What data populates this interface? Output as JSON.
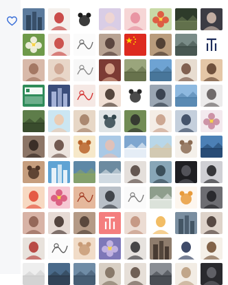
{
  "sidebar": {
    "favorite_icon": "heart-outline-icon"
  },
  "avatars": [
    {
      "label": "city-skyline",
      "bg": "#5b7a9c",
      "fg": "#2b3f55",
      "motif": "building"
    },
    {
      "label": "red-hat-girl",
      "bg": "#f4f0ec",
      "fg": "#c2302f",
      "motif": "face"
    },
    {
      "label": "panda",
      "bg": "#ffffff",
      "fg": "#1a1a1a",
      "motif": "animal"
    },
    {
      "label": "girl-purple",
      "bg": "#d9cde6",
      "fg": "#f1d6cf",
      "motif": "face"
    },
    {
      "label": "pink-girl",
      "bg": "#f6d6d6",
      "fg": "#e68a9a",
      "motif": "face"
    },
    {
      "label": "tulips",
      "bg": "#c8d9a6",
      "fg": "#e0503a",
      "motif": "flower"
    },
    {
      "label": "dark-forest",
      "bg": "#2e3b2a",
      "fg": "#6f7f55",
      "motif": "landscape"
    },
    {
      "label": "girl-dark",
      "bg": "#3c3c44",
      "fg": "#d9c1b3",
      "motif": "face"
    },
    {
      "label": "white-flower",
      "bg": "#6f9a4a",
      "fg": "#f8f5e8",
      "motif": "flower"
    },
    {
      "label": "santa-girl",
      "bg": "#f2e4e0",
      "fg": "#c53a35",
      "motif": "face"
    },
    {
      "label": "cartoon-sketch",
      "bg": "#fbfbfb",
      "fg": "#6b6b6b",
      "motif": "sketch"
    },
    {
      "label": "woman-portrait",
      "bg": "#b8a393",
      "fg": "#4a3630",
      "motif": "face"
    },
    {
      "label": "china-flag",
      "bg": "#dd2a1f",
      "fg": "#ffd400",
      "motif": "flag"
    },
    {
      "label": "man-temple",
      "bg": "#b99c7d",
      "fg": "#3f3128",
      "motif": "face"
    },
    {
      "label": "mountain-road",
      "bg": "#7a8c88",
      "fg": "#3c4a45",
      "motif": "landscape"
    },
    {
      "label": "logo-mark",
      "bg": "#ffffff",
      "fg": "#1c2b5a",
      "motif": "logo"
    },
    {
      "label": "hands",
      "bg": "#d8b9a9",
      "fg": "#9b6c58",
      "motif": "face"
    },
    {
      "label": "girl-sand",
      "bg": "#e8d6c8",
      "fg": "#caa08c",
      "motif": "face"
    },
    {
      "label": "text-sketch",
      "bg": "#f7f7f7",
      "fg": "#888888",
      "motif": "sketch"
    },
    {
      "label": "man-red",
      "bg": "#7c3b34",
      "fg": "#e5b59a",
      "motif": "face"
    },
    {
      "label": "field",
      "bg": "#9aa57c",
      "fg": "#5a6540",
      "motif": "landscape"
    },
    {
      "label": "lake-sky",
      "bg": "#6ea3d3",
      "fg": "#3e6a8c",
      "motif": "landscape"
    },
    {
      "label": "girl-smile",
      "bg": "#e7dcd0",
      "fg": "#6e4a3a",
      "motif": "face"
    },
    {
      "label": "old-man",
      "bg": "#e4c7a7",
      "fg": "#5b3c2a",
      "motif": "face"
    },
    {
      "label": "qr-card",
      "bg": "#2f8c5a",
      "fg": "#ffffff",
      "motif": "qr"
    },
    {
      "label": "city-night",
      "bg": "#3a4d7a",
      "fg": "#b9c4e8",
      "motif": "building"
    },
    {
      "label": "red-lantern",
      "bg": "#f5e8e4",
      "fg": "#d32f2f",
      "motif": "sketch"
    },
    {
      "label": "cute-girl",
      "bg": "#f1e0d5",
      "fg": "#3a2a22",
      "motif": "face"
    },
    {
      "label": "cartoon-bird",
      "bg": "#ffffff",
      "fg": "#2a2a2a",
      "motif": "animal"
    },
    {
      "label": "man-suit",
      "bg": "#9aa6b3",
      "fg": "#2a3340",
      "motif": "face"
    },
    {
      "label": "sea-sky",
      "bg": "#8eb9e0",
      "fg": "#4d7ea8",
      "motif": "landscape"
    },
    {
      "label": "man-glasses",
      "bg": "#ecebeb",
      "fg": "#5a5555",
      "motif": "face"
    },
    {
      "label": "tree-road",
      "bg": "#5e7d4a",
      "fg": "#2f4025",
      "motif": "landscape"
    },
    {
      "label": "cartoon-baby",
      "bg": "#cbe6f2",
      "fg": "#f1c7a8",
      "motif": "face"
    },
    {
      "label": "baby-face",
      "bg": "#e7d7c6",
      "fg": "#a07a60",
      "motif": "face"
    },
    {
      "label": "white-bird",
      "bg": "#dfe4e6",
      "fg": "#33474e",
      "motif": "animal"
    },
    {
      "label": "man-outdoor",
      "bg": "#718c55",
      "fg": "#2b2b2b",
      "motif": "face"
    },
    {
      "label": "woman-drawing",
      "bg": "#f4ede6",
      "fg": "#c49a82",
      "motif": "face"
    },
    {
      "label": "man-blue",
      "bg": "#c4cfdc",
      "fg": "#2f3e57",
      "motif": "face"
    },
    {
      "label": "flower-pink",
      "bg": "#f3e9ee",
      "fg": "#c98a9e",
      "motif": "flower"
    },
    {
      "label": "man-beard",
      "bg": "#8c7566",
      "fg": "#2d221c",
      "motif": "face"
    },
    {
      "label": "girl-white",
      "bg": "#ece4de",
      "fg": "#5d4238",
      "motif": "face"
    },
    {
      "label": "monkey-king",
      "bg": "#f6e8c9",
      "fg": "#b9632b",
      "motif": "animal"
    },
    {
      "label": "girl-beach",
      "bg": "#a9c9e6",
      "fg": "#e9c0b0",
      "motif": "face"
    },
    {
      "label": "ocean-cloud",
      "bg": "#7ea6cf",
      "fg": "#ffffff",
      "motif": "landscape"
    },
    {
      "label": "beach",
      "bg": "#b8d7e9",
      "fg": "#d8c6a4",
      "motif": "landscape"
    },
    {
      "label": "puppy",
      "bg": "#f4f0ea",
      "fg": "#8b6c55",
      "motif": "animal"
    },
    {
      "label": "coast",
      "bg": "#4c80b6",
      "fg": "#1f3f66",
      "motif": "landscape"
    },
    {
      "label": "cat",
      "bg": "#c69e7e",
      "fg": "#4e3527",
      "motif": "animal"
    },
    {
      "label": "lighthouse",
      "bg": "#5fa3d4",
      "fg": "#ffffff",
      "motif": "building"
    },
    {
      "label": "lake-green",
      "bg": "#5e88a6",
      "fg": "#8da65e",
      "motif": "landscape"
    },
    {
      "label": "wave",
      "bg": "#6d8ba0",
      "fg": "#e8eef2",
      "motif": "landscape"
    },
    {
      "label": "girl-sign",
      "bg": "#e4dfdb",
      "fg": "#4e3f38",
      "motif": "face"
    },
    {
      "label": "woman-teal",
      "bg": "#88a6b7",
      "fg": "#2e3f4a",
      "motif": "face"
    },
    {
      "label": "dark-portrait",
      "bg": "#1e1e22",
      "fg": "#5c5c63",
      "motif": "face"
    },
    {
      "label": "girl-black",
      "bg": "#cfcfd4",
      "fg": "#1b1b1e",
      "motif": "face"
    },
    {
      "label": "cartoon-boy",
      "bg": "#f7d9c2",
      "fg": "#e2442f",
      "motif": "face"
    },
    {
      "label": "lotus",
      "bg": "#f6c7d3",
      "fg": "#d8547a",
      "motif": "flower"
    },
    {
      "label": "poster",
      "bg": "#e5b89c",
      "fg": "#a23a22",
      "motif": "sketch"
    },
    {
      "label": "couple",
      "bg": "#b9c0c8",
      "fg": "#2b2f35",
      "motif": "face"
    },
    {
      "label": "ink-sketch",
      "bg": "#fafafa",
      "fg": "#7a7a7a",
      "motif": "sketch"
    },
    {
      "label": "waterfall",
      "bg": "#8e9e8c",
      "fg": "#eff2ee",
      "motif": "landscape"
    },
    {
      "label": "cartoon-cat",
      "bg": "#fdf6ee",
      "fg": "#e89b3b",
      "motif": "animal"
    },
    {
      "label": "man-dark",
      "bg": "#6d6d72",
      "fg": "#1e1e22",
      "motif": "face"
    },
    {
      "label": "baby-sleep",
      "bg": "#d8b3a6",
      "fg": "#8a5a4c",
      "motif": "face"
    },
    {
      "label": "girl-long-hair",
      "bg": "#e6dad4",
      "fg": "#3a2a24",
      "motif": "face"
    },
    {
      "label": "family",
      "bg": "#b49a86",
      "fg": "#4a3a30",
      "motif": "face"
    },
    {
      "label": "red-card",
      "bg": "#f47e7e",
      "fg": "#ffffff",
      "motif": "logo"
    },
    {
      "label": "girl-sweater",
      "bg": "#ecdcd3",
      "fg": "#bf8e78",
      "motif": "face"
    },
    {
      "label": "cartoon-kid",
      "bg": "#ffffff",
      "fg": "#f0b14a",
      "motif": "face"
    },
    {
      "label": "city-river",
      "bg": "#7a8ea0",
      "fg": "#3b4c5b",
      "motif": "building"
    },
    {
      "label": "woman-hat",
      "bg": "#ded3ca",
      "fg": "#3f302b",
      "motif": "face"
    },
    {
      "label": "man-cap",
      "bg": "#e8e2dc",
      "fg": "#b0302c",
      "motif": "face"
    },
    {
      "label": "line-drawing",
      "bg": "#fbfbfb",
      "fg": "#5a5a5a",
      "motif": "sketch"
    },
    {
      "label": "bunny",
      "bg": "#f1dcc8",
      "fg": "#c89b77",
      "motif": "animal"
    },
    {
      "label": "purple-flowers",
      "bg": "#7e78b8",
      "fg": "#c9b8e6",
      "motif": "flower"
    },
    {
      "label": "man-black",
      "bg": "#e6e2de",
      "fg": "#2a2a2d",
      "motif": "face"
    },
    {
      "label": "crowd",
      "bg": "#8e7c6c",
      "fg": "#3c3028",
      "motif": "building"
    },
    {
      "label": "anime-boy",
      "bg": "#ffffff",
      "fg": "#1d2b4f",
      "motif": "face"
    },
    {
      "label": "cartoon-figure",
      "bg": "#f5f0e8",
      "fg": "#6d4a2b",
      "motif": "face"
    },
    {
      "label": "row-10-1",
      "bg": "#eeeeee",
      "fg": "#cccccc",
      "motif": "landscape"
    },
    {
      "label": "row-10-2",
      "bg": "#4a6a8a",
      "fg": "#2a3a4a",
      "motif": "landscape"
    },
    {
      "label": "row-10-3",
      "bg": "#6f8ca6",
      "fg": "#3d5268",
      "motif": "landscape"
    },
    {
      "label": "row-10-4",
      "bg": "#d8cfc4",
      "fg": "#7a6a5a",
      "motif": "face"
    },
    {
      "label": "row-10-5",
      "bg": "#e6dfd8",
      "fg": "#5a4a40",
      "motif": "face"
    },
    {
      "label": "row-10-6",
      "bg": "#8a8e94",
      "fg": "#3a3e44",
      "motif": "landscape"
    },
    {
      "label": "row-10-7",
      "bg": "#f2ece4",
      "fg": "#b89a7a",
      "motif": "face"
    },
    {
      "label": "row-10-8",
      "bg": "#2a2a2e",
      "fg": "#6a6a70",
      "motif": "face"
    }
  ]
}
